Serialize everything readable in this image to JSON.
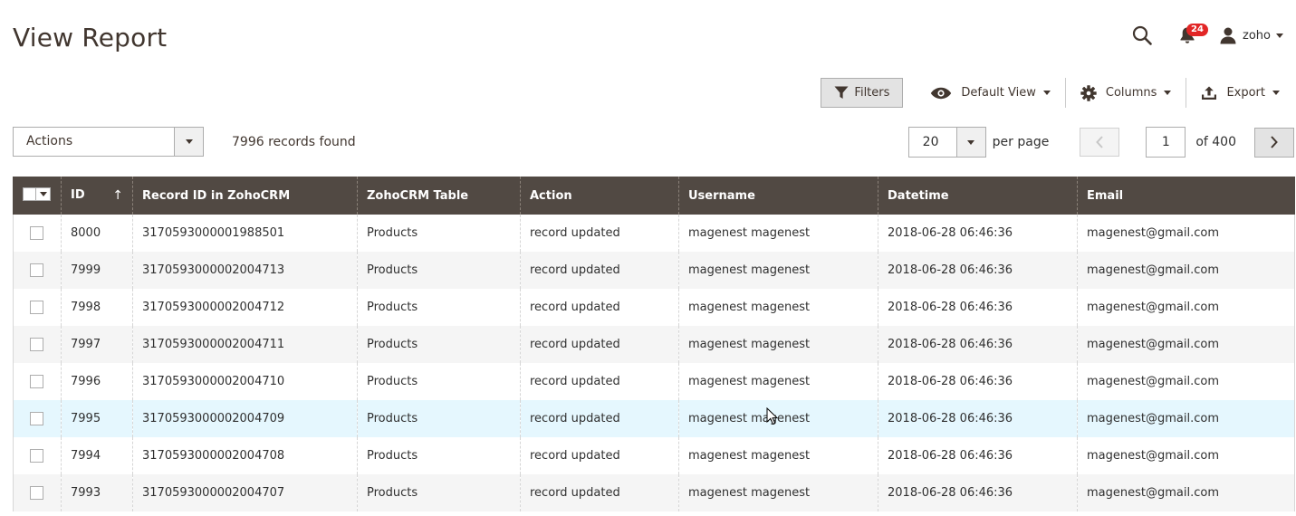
{
  "page": {
    "title": "View Report"
  },
  "header": {
    "notification_count": "24",
    "username": "zoho"
  },
  "toolbar": {
    "filters_label": "Filters",
    "view_label": "Default View",
    "columns_label": "Columns",
    "export_label": "Export"
  },
  "actions": {
    "selected": "Actions"
  },
  "records": {
    "found_text": "7996 records found"
  },
  "pager": {
    "per_page_value": "20",
    "per_page_label": "per page",
    "current_page": "1",
    "of_text": "of 400"
  },
  "grid": {
    "columns": [
      "ID",
      "Record ID in ZohoCRM",
      "ZohoCRM Table",
      "Action",
      "Username",
      "Datetime",
      "Email"
    ],
    "rows": [
      [
        "8000",
        "3170593000001988501",
        "Products",
        "record updated",
        "magenest magenest",
        "2018-06-28 06:46:36",
        "magenest@gmail.com"
      ],
      [
        "7999",
        "3170593000002004713",
        "Products",
        "record updated",
        "magenest magenest",
        "2018-06-28 06:46:36",
        "magenest@gmail.com"
      ],
      [
        "7998",
        "3170593000002004712",
        "Products",
        "record updated",
        "magenest magenest",
        "2018-06-28 06:46:36",
        "magenest@gmail.com"
      ],
      [
        "7997",
        "3170593000002004711",
        "Products",
        "record updated",
        "magenest magenest",
        "2018-06-28 06:46:36",
        "magenest@gmail.com"
      ],
      [
        "7996",
        "3170593000002004710",
        "Products",
        "record updated",
        "magenest magenest",
        "2018-06-28 06:46:36",
        "magenest@gmail.com"
      ],
      [
        "7995",
        "3170593000002004709",
        "Products",
        "record updated",
        "magenest magenest",
        "2018-06-28 06:46:36",
        "magenest@gmail.com"
      ],
      [
        "7994",
        "3170593000002004708",
        "Products",
        "record updated",
        "magenest magenest",
        "2018-06-28 06:46:36",
        "magenest@gmail.com"
      ],
      [
        "7993",
        "3170593000002004707",
        "Products",
        "record updated",
        "magenest magenest",
        "2018-06-28 06:46:36",
        "magenest@gmail.com"
      ]
    ]
  },
  "colors": {
    "header_bg": "#514943",
    "badge": "#e22626",
    "hover_row": "#e5f7fe"
  }
}
